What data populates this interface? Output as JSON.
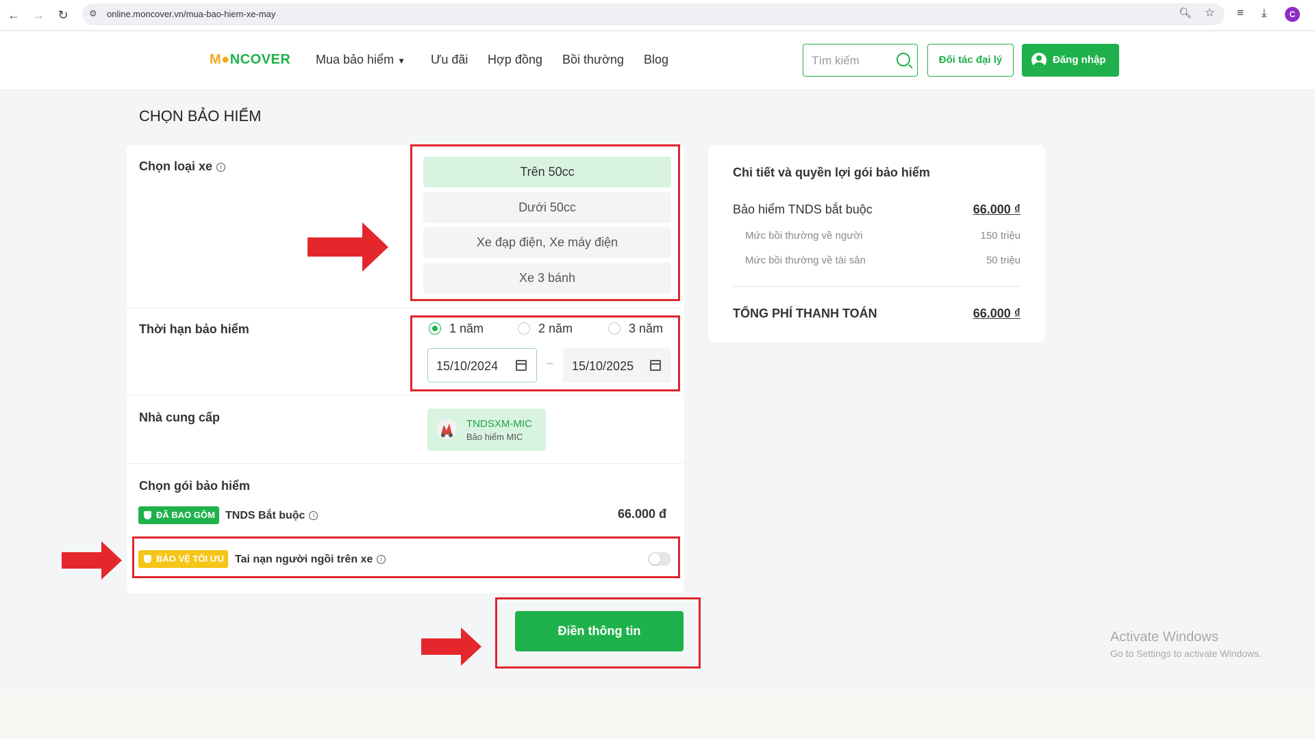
{
  "browser": {
    "url": "online.moncover.vn/mua-bao-hiem-xe-may",
    "profile_initial": "C"
  },
  "header": {
    "logo_parts": [
      "M",
      "●",
      "NCOVER"
    ],
    "menu": [
      {
        "label": "Mua bảo hiểm",
        "has_dropdown": true
      },
      {
        "label": "Ưu đãi"
      },
      {
        "label": "Hợp đồng"
      },
      {
        "label": "Bồi thường"
      },
      {
        "label": "Blog"
      }
    ],
    "search_placeholder": "Tìm kiếm",
    "partner_label": "Đối tác đại lý",
    "login_label": "Đăng nhập",
    "accent_color": "#1fb14b"
  },
  "page_title": "CHỌN BẢO HIỂM",
  "vehicle": {
    "label": "Chọn loại xe",
    "options": [
      "Trên 50cc",
      "Dưới 50cc",
      "Xe đạp điện, Xe máy điện",
      "Xe 3 bánh"
    ],
    "selected": "Trên 50cc"
  },
  "term": {
    "label": "Thời hạn bảo hiểm",
    "options": [
      "1 năm",
      "2 năm",
      "3 năm"
    ],
    "selected": "1 năm",
    "start_date": "15/10/2024",
    "end_date": "15/10/2025",
    "separator": "–"
  },
  "provider": {
    "label": "Nhà cung cấp",
    "name": "TNDSXM-MIC",
    "sub": "Bảo hiểm MIC"
  },
  "package": {
    "label": "Chọn gói bảo hiểm",
    "included_badge": "ĐÃ BAO GỒM",
    "included_name": "TNDS Bắt buộc",
    "included_price": "66.000 đ",
    "optional_badge": "BẢO VỆ TỐI ƯU",
    "optional_name": "Tai nạn người ngồi trên xe",
    "optional_enabled": false
  },
  "submit_label": "Điền thông tin",
  "summary": {
    "title": "Chi tiết và quyền lợi gói bảo hiểm",
    "main_label": "Bảo hiểm TNDS bắt buộc",
    "main_value": "66.000 ₫",
    "sub_rows": [
      {
        "label": "Mức bồi thường về người",
        "value": "150 triệu"
      },
      {
        "label": "Mức bồi thường về tài sản",
        "value": "50 triệu"
      }
    ],
    "total_label": "TỔNG PHÍ THANH TOÁN",
    "total_value": "66.000 ₫"
  },
  "watermark": {
    "title": "Activate Windows",
    "subtitle": "Go to Settings to activate Windows."
  }
}
